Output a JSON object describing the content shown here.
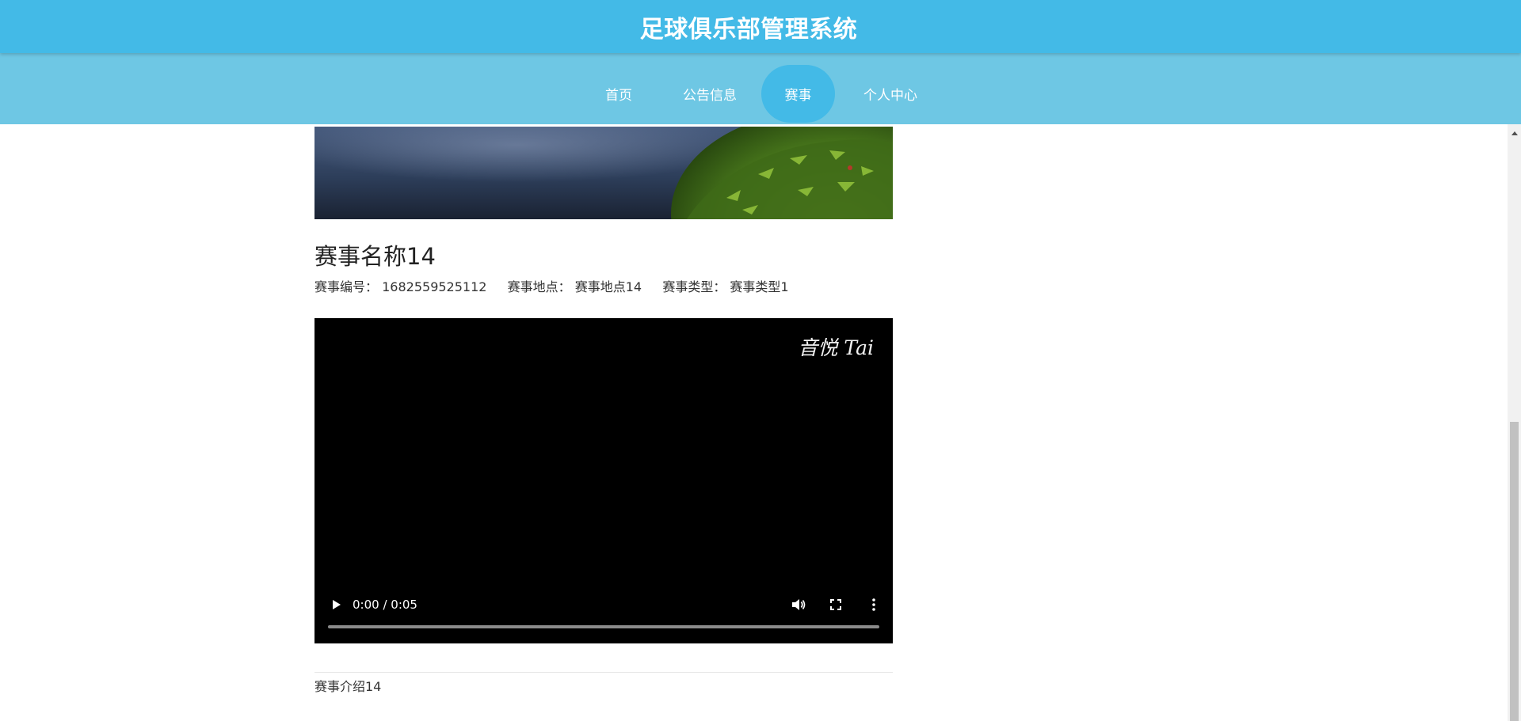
{
  "header": {
    "site_title": "足球俱乐部管理系统"
  },
  "nav": {
    "items": [
      {
        "label": "首页",
        "active": false
      },
      {
        "label": "公告信息",
        "active": false
      },
      {
        "label": "赛事",
        "active": true
      },
      {
        "label": "个人中心",
        "active": false
      }
    ]
  },
  "detail": {
    "title": "赛事名称14",
    "meta": {
      "number_label": "赛事编号：",
      "number_value": "1682559525112",
      "place_label": "赛事地点：",
      "place_value": "赛事地点14",
      "type_label": "赛事类型：",
      "type_value": "赛事类型1"
    },
    "video": {
      "watermark": "音悦 Tai",
      "time": "0:00 / 0:05",
      "progress": 0
    },
    "intro": "赛事介绍14"
  },
  "theme": {
    "header_color": "#43bae7",
    "nav_color": "#6ec7e4",
    "active_color": "#43bae7"
  }
}
